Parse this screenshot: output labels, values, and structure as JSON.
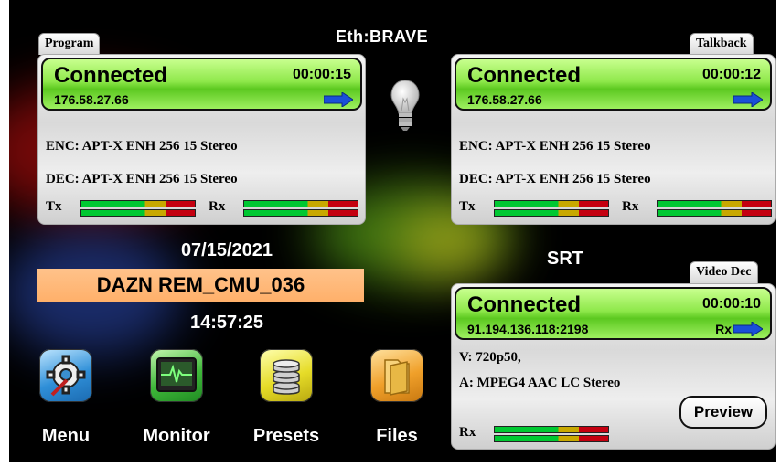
{
  "network_title": "Eth:BRAVE",
  "program": {
    "tab": "Program",
    "status": "Connected",
    "elapsed": "00:00:15",
    "address": "176.58.27.66",
    "enc": "ENC: APT-X ENH 256 15 Stereo",
    "dec": "DEC: APT-X ENH 256 15 Stereo",
    "tx_label": "Tx",
    "rx_label": "Rx",
    "tx_level": 0.0,
    "rx_level": 0.0
  },
  "talkback": {
    "tab": "Talkback",
    "status": "Connected",
    "elapsed": "00:00:12",
    "address": "176.58.27.66",
    "enc": "ENC: APT-X ENH 256 15 Stereo",
    "dec": "DEC: APT-X ENH 256 15 Stereo",
    "tx_label": "Tx",
    "rx_label": "Rx",
    "tx_level": 0.45,
    "rx_level": 0.0
  },
  "date": "07/15/2021",
  "time": "14:57:25",
  "codec_name": "DAZN REM_CMU_036",
  "srt": {
    "title": "SRT",
    "tab": "Video Dec",
    "status": "Connected",
    "elapsed": "00:00:10",
    "address": "91.194.136.118:2198",
    "direction": "Rx",
    "video": "V: 720p50,",
    "audio": "A: MPEG4 AAC LC Stereo",
    "rx_label": "Rx",
    "rx_level": 0.0,
    "preview_label": "Preview"
  },
  "apps": [
    {
      "label": "Menu",
      "icon": "gear-wrench-icon",
      "color": "#3ea6e0"
    },
    {
      "label": "Monitor",
      "icon": "waveform-monitor-icon",
      "color": "#52c24a"
    },
    {
      "label": "Presets",
      "icon": "database-icon",
      "color": "#e8e23a"
    },
    {
      "label": "Files",
      "icon": "folder-icon",
      "color": "#f0a02a"
    }
  ],
  "colors": {
    "connected_green": "#7ee03a",
    "name_box": "#ffb878",
    "arrow_blue": "#1a4fd8",
    "meter_green": "#00c832",
    "meter_yellow": "#c8a800",
    "meter_red": "#c40010"
  }
}
